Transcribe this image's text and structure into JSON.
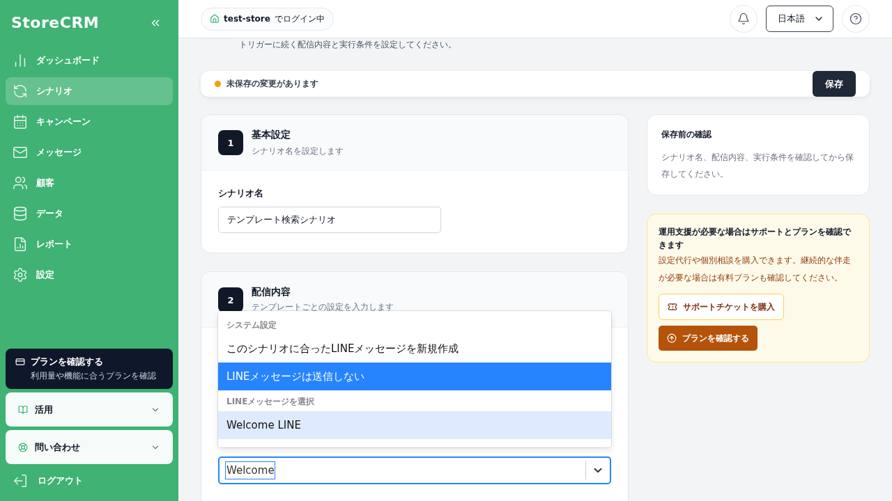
{
  "sidebar": {
    "logo": "StoreCRM",
    "items": [
      {
        "label": "ダッシュボード",
        "selected": false
      },
      {
        "label": "シナリオ",
        "selected": true
      },
      {
        "label": "キャンペーン",
        "selected": false
      },
      {
        "label": "メッセージ",
        "selected": false
      },
      {
        "label": "顧客",
        "selected": false
      },
      {
        "label": "データ",
        "selected": false
      },
      {
        "label": "レポート",
        "selected": false
      },
      {
        "label": "設定",
        "selected": false
      }
    ],
    "plan_card": {
      "title": "プランを確認する",
      "subtitle": "利用量や機能に合うプランを確認"
    },
    "sections": [
      {
        "label": "活用",
        "expanded": false
      },
      {
        "label": "問い合わせ",
        "expanded": false
      }
    ],
    "logout": "ログアウト"
  },
  "header": {
    "store": "test-store",
    "store_suffix": "でログイン中",
    "language": "日本語"
  },
  "page": {
    "description": "トリガーに続く配信内容と実行条件を設定してください。"
  },
  "unsaved_bar": {
    "message": "未保存の変更があります",
    "save": "保存"
  },
  "steps": [
    {
      "number": "1",
      "title": "基本設定",
      "subtitle": "シナリオ名を設定します",
      "field_label": "シナリオ名",
      "field_value": "テンプレート検索シナリオ"
    },
    {
      "number": "2",
      "title": "配信内容",
      "subtitle": "テンプレートごとの設定を入力します",
      "search_value": "Welcome"
    }
  ],
  "dropdown": {
    "groups": [
      {
        "label": "システム設定",
        "options": [
          {
            "label": "このシナリオに合ったLINEメッセージを新規作成",
            "selected": false,
            "highlighted": false
          },
          {
            "label": "LINEメッセージは送信しない",
            "selected": true,
            "highlighted": false
          }
        ]
      },
      {
        "label": "LINEメッセージを選択",
        "options": [
          {
            "label": "Welcome LINE",
            "selected": false,
            "highlighted": true
          }
        ]
      }
    ]
  },
  "review_card": {
    "title": "保存前の確認",
    "body": "シナリオ名、配信内容、実行条件を確認してから保存してください。"
  },
  "support_card": {
    "title": "運用支援が必要な場合はサポートとプランを確認できます",
    "body": "設定代行や個別相談を購入できます。継続的な伴走が必要な場合は有料プランも確認してください。",
    "ticket_button": "サポートチケットを購入",
    "plan_button": "プランを確認する"
  }
}
